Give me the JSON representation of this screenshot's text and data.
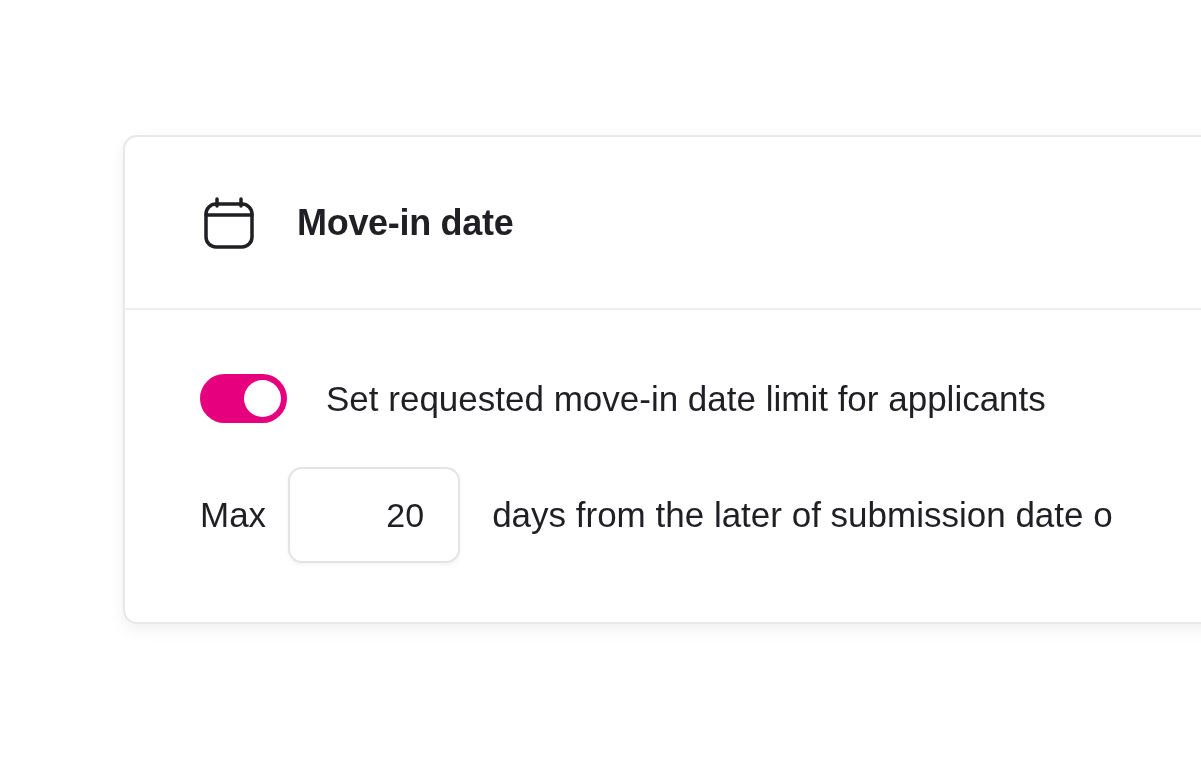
{
  "card": {
    "title": "Move-in date",
    "toggle": {
      "on": true,
      "label": "Set requested move-in date limit for applicants"
    },
    "limit": {
      "prefix": "Max",
      "value": "20",
      "suffix": "days from the later of submission date o"
    }
  }
}
